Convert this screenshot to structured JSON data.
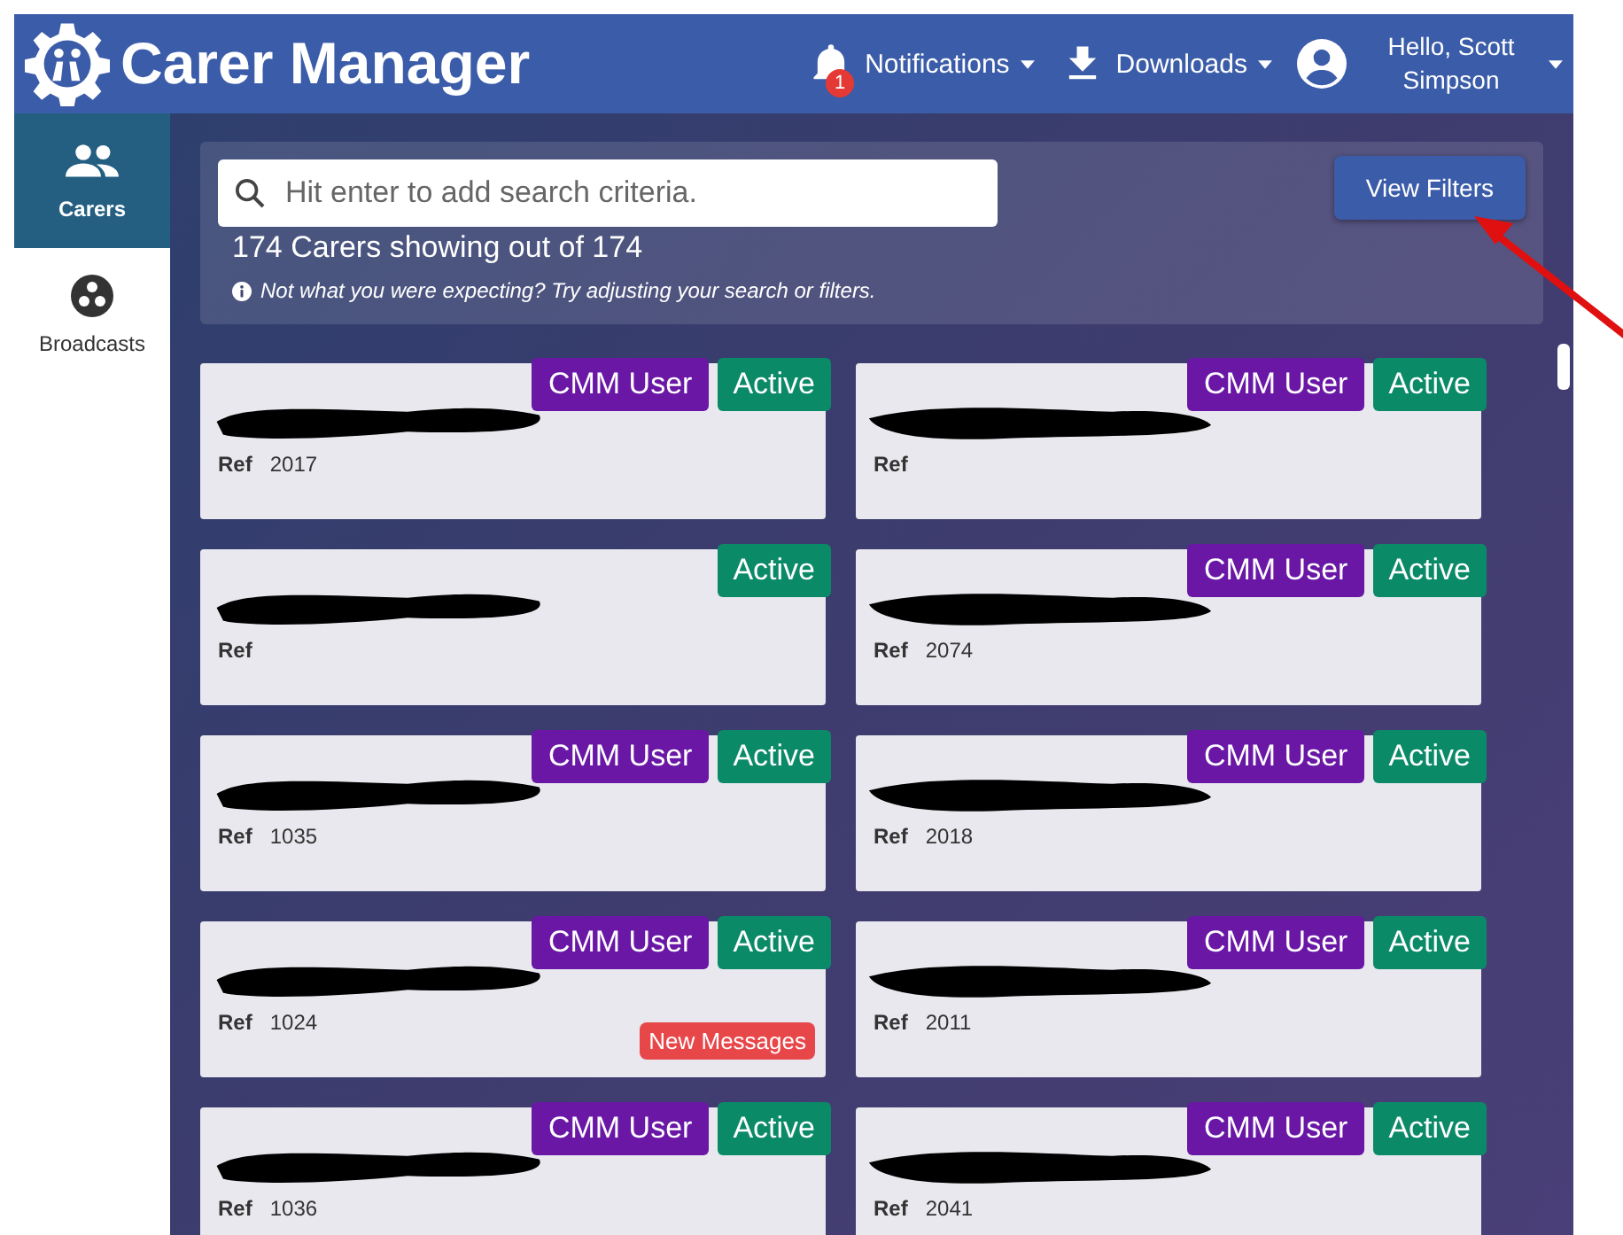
{
  "header": {
    "title": "Carer Manager",
    "notifications": {
      "label": "Notifications",
      "count": "1"
    },
    "downloads": {
      "label": "Downloads"
    },
    "user": {
      "greeting": "Hello, Scott Simpson"
    }
  },
  "sidebar": {
    "items": [
      {
        "label": "Carers",
        "kind": "people",
        "selected": true
      },
      {
        "label": "Broadcasts",
        "kind": "broadcast",
        "selected": false
      }
    ]
  },
  "search": {
    "placeholder": "Hit enter to add search criteria.",
    "summary": "174 Carers showing out of 174",
    "hint": "Not what you were expecting? Try adjusting your search or filters.",
    "filters_button": "View Filters"
  },
  "cards": [
    {
      "ref_label": "Ref",
      "ref": "2017",
      "badges": [
        {
          "kind": "role",
          "label": "CMM User"
        },
        {
          "kind": "status",
          "label": "Active"
        }
      ]
    },
    {
      "ref_label": "Ref",
      "badges": [
        {
          "kind": "role",
          "label": "CMM User"
        },
        {
          "kind": "status",
          "label": "Active"
        }
      ]
    },
    {
      "ref_label": "Ref",
      "badges": [
        {
          "kind": "status",
          "label": "Active"
        }
      ]
    },
    {
      "ref_label": "Ref",
      "ref": "2074",
      "badges": [
        {
          "kind": "role",
          "label": "CMM User"
        },
        {
          "kind": "status",
          "label": "Active"
        }
      ]
    },
    {
      "ref_label": "Ref",
      "ref": "1035",
      "badges": [
        {
          "kind": "role",
          "label": "CMM User"
        },
        {
          "kind": "status",
          "label": "Active"
        }
      ]
    },
    {
      "ref_label": "Ref",
      "ref": "2018",
      "badges": [
        {
          "kind": "role",
          "label": "CMM User"
        },
        {
          "kind": "status",
          "label": "Active"
        }
      ]
    },
    {
      "ref_label": "Ref",
      "ref": "1024",
      "badges": [
        {
          "kind": "role",
          "label": "CMM User"
        },
        {
          "kind": "status",
          "label": "Active"
        }
      ],
      "alert": "New Messages"
    },
    {
      "ref_label": "Ref",
      "ref": "2011",
      "badges": [
        {
          "kind": "role",
          "label": "CMM User"
        },
        {
          "kind": "status",
          "label": "Active"
        }
      ]
    },
    {
      "ref_label": "Ref",
      "ref": "1036",
      "badges": [
        {
          "kind": "role",
          "label": "CMM User"
        },
        {
          "kind": "status",
          "label": "Active"
        }
      ]
    },
    {
      "ref_label": "Ref",
      "ref": "2041",
      "badges": [
        {
          "kind": "role",
          "label": "CMM User"
        },
        {
          "kind": "status",
          "label": "Active"
        }
      ]
    }
  ]
}
